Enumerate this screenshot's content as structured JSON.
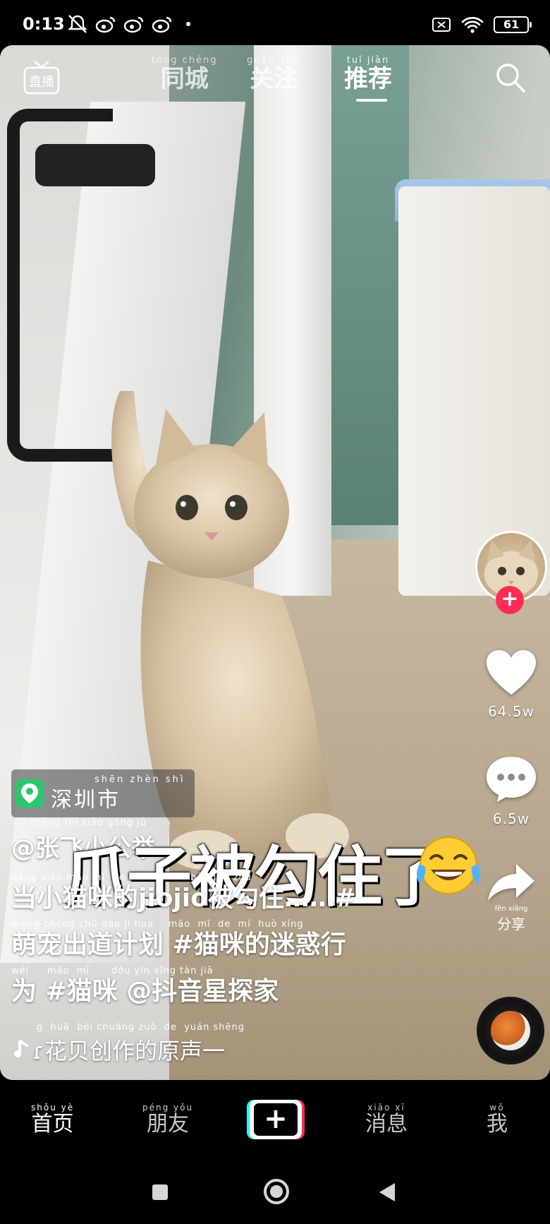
{
  "status_bar": {
    "time": "0:13",
    "battery": "61",
    "left_icons": [
      "notifications-off-icon",
      "weibo-icon",
      "weibo-icon",
      "weibo-icon",
      "dot-icon"
    ],
    "right_icons": [
      "sim-off-icon",
      "wifi-icon",
      "battery-icon"
    ]
  },
  "top_nav": {
    "live_label": "直播",
    "tabs": [
      {
        "pinyin": "tóng chéng",
        "label": "同城",
        "active": false
      },
      {
        "pinyin": "guān zhù",
        "label": "关注",
        "active": false
      },
      {
        "pinyin": "tuī jiàn",
        "label": "推荐",
        "active": true
      }
    ]
  },
  "video": {
    "subtitle_overlay": "爪子被勾住了",
    "subtitle_emoji": "face-with-tears-of-joy-icon"
  },
  "right_rail": {
    "like_count": "64.5w",
    "comment_count": "6.5w",
    "share_pinyin": "fēn xiǎng",
    "share_label": "分享"
  },
  "location": {
    "pinyin": "shēn zhèn shì",
    "label": "深圳市"
  },
  "author": {
    "pinyin": "zhāng fēi xiǎo gōng jǔ",
    "handle": "@张飞小公举"
  },
  "description": {
    "lines": [
      {
        "pinyin": "dāng xiǎo māo mī  de                  bèi gōu zhù",
        "text": "当小猫咪的jiojio被勾住……#"
      },
      {
        "pinyin": "méng chǒng chū dào jì huà    māo  mī  de  mí  huò xíng",
        "text": "萌宠出道计划 #猫咪的迷惑行"
      },
      {
        "pinyin": "wéi     māo  mī      dǒu yīn xīng tàn jiā",
        "text": "为 #猫咪 @抖音星探家"
      }
    ]
  },
  "music": {
    "pinyin": "g  huā  bèi chuàng zuò  de  yuán shēng",
    "text": "ɾ花贝创作的原声一"
  },
  "bottom_nav": {
    "items": [
      {
        "pinyin": "shǒu yè",
        "label": "首页",
        "active": true
      },
      {
        "pinyin": "péng yǒu",
        "label": "朋友",
        "active": false
      },
      {
        "pinyin": "xiāo xī",
        "label": "消息",
        "active": false
      },
      {
        "pinyin": "wǒ",
        "label": "我",
        "active": false
      }
    ],
    "create_label": "+"
  },
  "colors": {
    "accent_red": "#fe2c55",
    "accent_cyan": "#25f4ee",
    "location_green": "#2bc66f"
  }
}
